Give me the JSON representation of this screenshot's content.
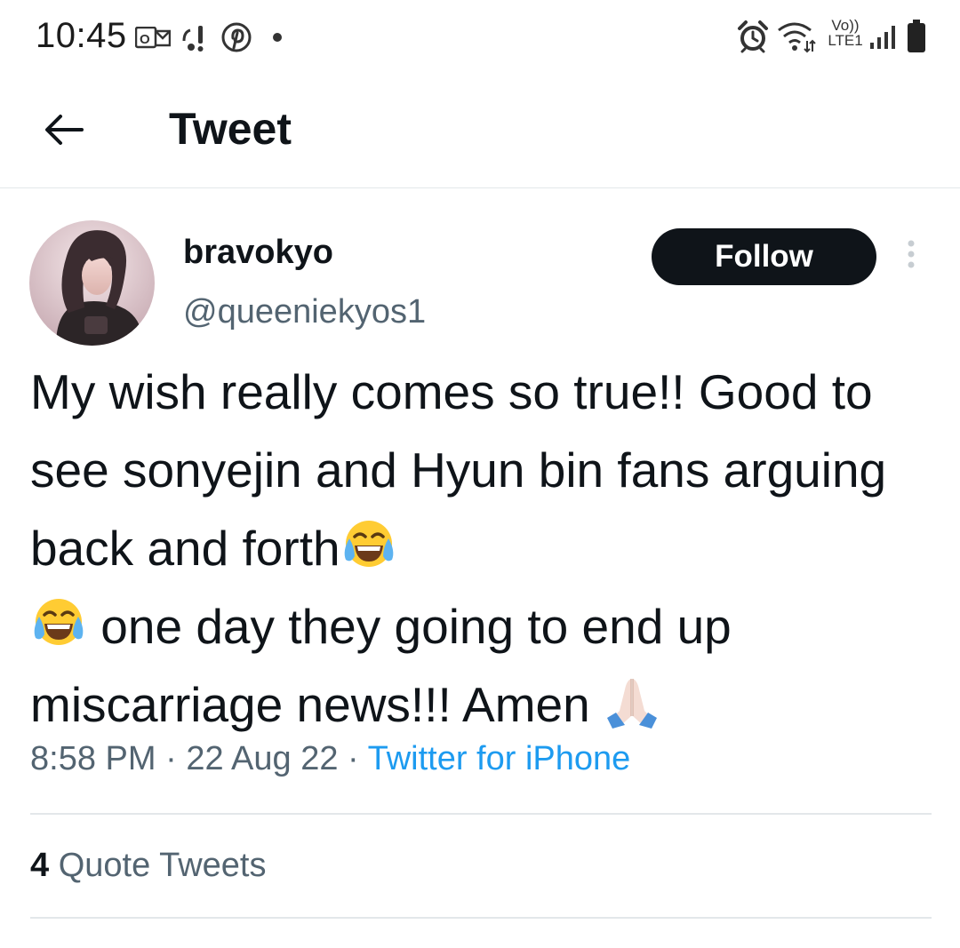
{
  "status_bar": {
    "time": "10:45",
    "network_label_top": "Vo))",
    "network_label_bottom": "LTE1",
    "icons": [
      "outlook-icon",
      "alert-icon",
      "pinterest-icon",
      "dot-icon",
      "alarm-icon",
      "wifi-icon",
      "signal-icon",
      "battery-icon"
    ]
  },
  "app_bar": {
    "back_icon": "arrow-left-icon",
    "title": "Tweet"
  },
  "tweet": {
    "author": {
      "display_name": "bravokyo",
      "handle": "@queeniekyos1"
    },
    "follow_label": "Follow",
    "more_icon": "more-vertical-icon",
    "text_parts": {
      "p1": "My wish really comes so true!! Good to see sonyejin and Hyun bin fans arguing back and forth",
      "p2": " one day they going to end up miscarriage news!!! Amen "
    },
    "emojis": [
      "tears-of-joy-emoji",
      "tears-of-joy-emoji",
      "folded-hands-emoji"
    ],
    "time": "8:58 PM",
    "separator": " · ",
    "date": "22 Aug 22",
    "source": "Twitter for iPhone"
  },
  "stats": {
    "quote_count": "4",
    "quote_label": " Quote Tweets"
  },
  "colors": {
    "text_primary": "#0f1419",
    "text_secondary": "#536471",
    "link": "#1d9bf0",
    "divider": "#e3e7ea",
    "button_bg": "#0f1419"
  }
}
